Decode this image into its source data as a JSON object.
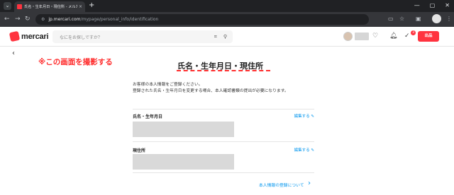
{
  "browser": {
    "tab_title": "氏名・生年月日・現住所 - メルカリ",
    "tab_close": "×",
    "new_tab": "+",
    "url_domain": "jp.mercari.com",
    "url_path": "/mypage/personal_info/identification",
    "menu_icon": "⌄",
    "back": "←",
    "forward": "→",
    "reload": "↻",
    "win_minimize": "—",
    "win_maximize": "▢",
    "win_close": "✕"
  },
  "header": {
    "logo_text": "mercari",
    "search_placeholder": "なにをお探しですか？",
    "sell_label": "出品",
    "notification_count": "3",
    "accent_color": "#ff333f"
  },
  "page": {
    "annotation": "※この画面を撮影する",
    "title": "氏名・生年月日・現住所",
    "intro_line1": "お客様の本人情報をご登録ください。",
    "intro_line2": "登録された氏名・生年月日を変更する場合、本人確認書類の提出が必要になります。",
    "section_name": {
      "label": "氏名・生年月日",
      "edit": "編集する"
    },
    "section_address": {
      "label": "現住所",
      "edit": "編集する"
    },
    "footer_link": "本人情報の登録について"
  },
  "icons": {
    "search": "search-icon",
    "camera": "camera-scan-icon",
    "heart": "heart-icon",
    "bell": "bell-icon",
    "check": "todo-check-icon",
    "edit": "pencil-icon",
    "back": "chevron-left-icon",
    "chevron_right": "chevron-right-icon"
  }
}
